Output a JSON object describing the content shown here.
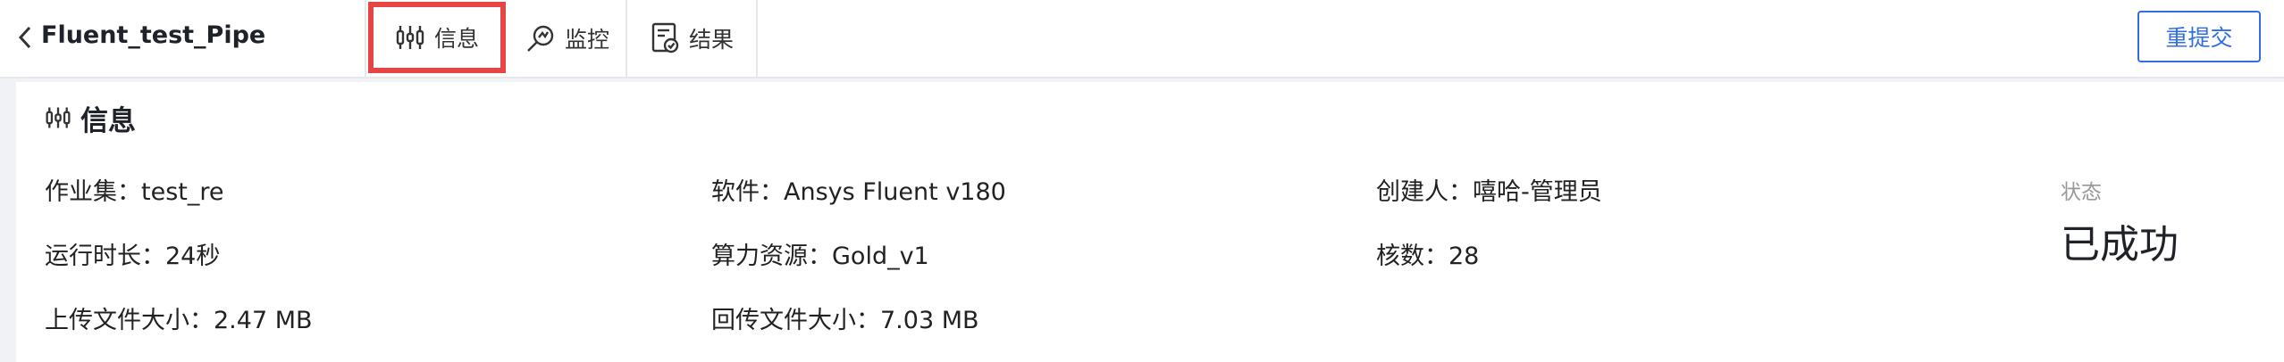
{
  "header": {
    "title": "Fluent_test_Pipe",
    "tabs": [
      {
        "label": "信息",
        "icon": "adjustments-icon",
        "active": true
      },
      {
        "label": "监控",
        "icon": "monitor-search-icon",
        "active": false
      },
      {
        "label": "结果",
        "icon": "result-document-icon",
        "active": false
      }
    ],
    "resubmit_label": "重提交"
  },
  "info": {
    "section_title": "信息",
    "fields": {
      "job_set": "作业集：test_re",
      "software": "软件：Ansys Fluent v180",
      "creator": "创建人：嘻哈-管理员",
      "runtime": "运行时长：24秒",
      "resource": "算力资源：Gold_v1",
      "cores": "核数：28",
      "upload_size": "上传文件大小：2.47 MB",
      "return_size": "回传文件大小：7.03 MB"
    },
    "status_label": "状态",
    "status_value": "已成功"
  },
  "colors": {
    "accent": "#2f6ee5",
    "highlight": "#e54545"
  }
}
